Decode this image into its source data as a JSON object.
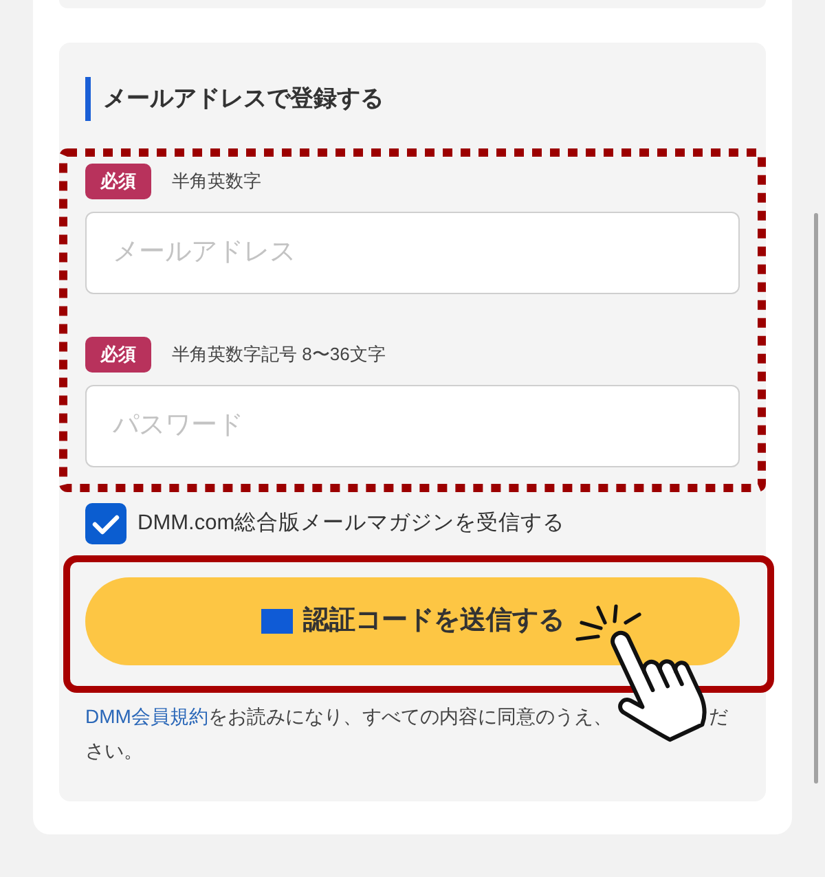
{
  "heading": "メールアドレスで登録する",
  "fields": [
    {
      "badge": "必須",
      "hint": "半角英数字",
      "placeholder": "メールアドレス"
    },
    {
      "badge": "必須",
      "hint": "半角英数字記号 8〜36文字",
      "placeholder": "パスワード"
    }
  ],
  "newsletter": {
    "label": "DMM.com総合版メールマガジンを受信する",
    "checked": true
  },
  "submit_button": {
    "label": "認証コードを送信する"
  },
  "terms_note": {
    "link": "DMM会員規約",
    "text": "をお読みになり、すべての内容に同意のうえ、",
    "text_after_cursor": "ださい。"
  }
}
